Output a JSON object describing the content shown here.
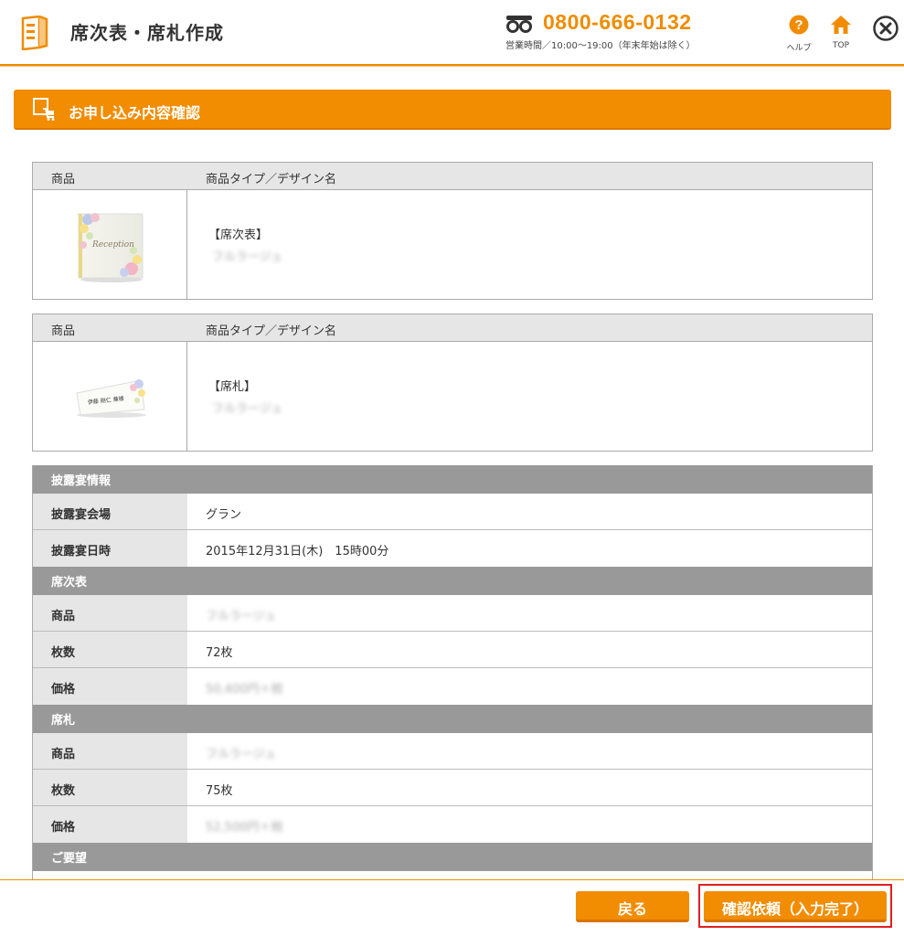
{
  "header": {
    "title": "席次表・席札作成",
    "phone": "0800-666-0132",
    "hours": "営業時間／10:00～19:00（年末年始は除く）",
    "help_label": "ヘルプ",
    "top_label": "TOP"
  },
  "section": {
    "title": "お申し込み内容確認"
  },
  "products": [
    {
      "col_product": "商品",
      "col_type": "商品タイプ／デザイン名",
      "type": "【席次表】",
      "design": "フルラージュ",
      "image_text": "Reception"
    },
    {
      "col_product": "商品",
      "col_type": "商品タイプ／デザイン名",
      "type": "【席札】",
      "design": "フルラージュ",
      "image_text": "伊藤 剛仁 兼様"
    }
  ],
  "info": {
    "reception": {
      "header": "披露宴情報",
      "venue_label": "披露宴会場",
      "venue": "グラン",
      "datetime_label": "披露宴日時",
      "datetime": "2015年12月31日(木)　15時00分"
    },
    "seating_chart": {
      "header": "席次表",
      "product_label": "商品",
      "product": "フルラージュ",
      "count_label": "枚数",
      "count": "72枚",
      "price_label": "価格",
      "price": "50,400円＋税"
    },
    "place_card": {
      "header": "席札",
      "product_label": "商品",
      "product": "フルラージュ",
      "count_label": "枚数",
      "count": "75枚",
      "price_label": "価格",
      "price": "52,500円＋税"
    },
    "request": {
      "header": "ご要望"
    }
  },
  "footer": {
    "back_label": "戻る",
    "confirm_label": "確認依頼（入力完了）"
  },
  "colors": {
    "accent": "#f28c00",
    "section_gray": "#999999",
    "highlight": "#e02020"
  }
}
